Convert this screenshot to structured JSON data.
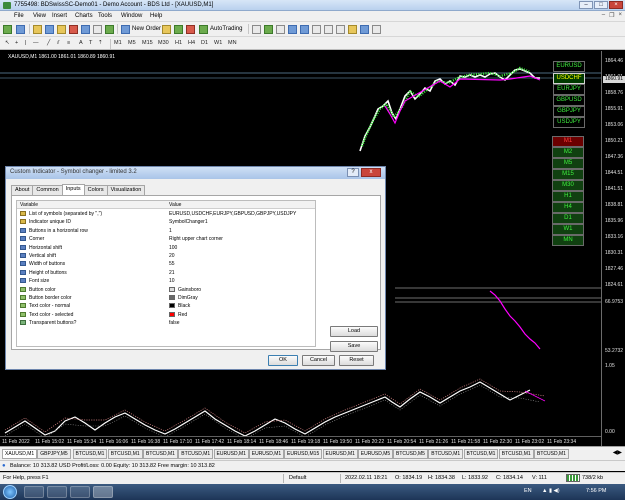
{
  "window": {
    "title": "7755498: BDSwissSC-Demo01 - Demo Account - BDS Ltd - [XAUUSD,M1]"
  },
  "menu": {
    "items": [
      "File",
      "View",
      "Insert",
      "Charts",
      "Tools",
      "Window",
      "Help"
    ]
  },
  "toolbar": {
    "new_order": "New Order",
    "autotrading": "AutoTrading"
  },
  "timeframes": [
    "M1",
    "M5",
    "M15",
    "M30",
    "H1",
    "H4",
    "D1",
    "W1",
    "MN"
  ],
  "chart": {
    "label": "XAUUSD,M1  1861.00 1861.01 1860.89 1860.91",
    "price_labels": [
      "1864.46",
      "1861.01",
      "1858.76",
      "1855.91",
      "1853.06",
      "1850.21",
      "1847.36",
      "1844.51",
      "1841.51",
      "1838.81",
      "1835.96",
      "1833.16",
      "1830.31",
      "1827.46",
      "1824.61",
      "66.9753",
      "53.2732",
      "1.05",
      "0.00"
    ],
    "current_price": "1860.91",
    "time_labels": [
      "11 Feb 2022",
      "11 Feb 15:02",
      "11 Feb 15:34",
      "11 Feb 16:06",
      "11 Feb 16:38",
      "11 Feb 17:10",
      "11 Feb 17:42",
      "11 Feb 18:14",
      "11 Feb 18:46",
      "11 Feb 19:18",
      "11 Feb 19:50",
      "11 Feb 20:22",
      "11 Feb 20:54",
      "11 Feb 21:26",
      "11 Feb 21:58",
      "11 Feb 22:30",
      "11 Feb 23:02",
      "11 Feb 23:34"
    ],
    "symbol_buttons": [
      "EURUSD",
      "USDCHF",
      "EURJPY",
      "GBPUSD",
      "GBPJPY",
      "USDJPY"
    ],
    "selected_symbol": "USDCHF",
    "timeframe_buttons": [
      "M1",
      "M2",
      "M5",
      "M15",
      "M30",
      "H1",
      "H4",
      "D1",
      "W1",
      "MN"
    ],
    "selected_timeframe": "M1"
  },
  "dialog": {
    "title": "Custom Indicator - Symbol changer - limited 3.2",
    "help": "?",
    "close": "x",
    "tabs": [
      "About",
      "Common",
      "Inputs",
      "Colors",
      "Visualization"
    ],
    "active_tab": "Inputs",
    "columns": [
      "Variable",
      "Value"
    ],
    "rows": [
      {
        "name": "List of symbols (separated by \",\")",
        "value": "EURUSD,USDCHF,EURJPY,GBPUSD,GBPJPY,USDJPY",
        "kind": "s"
      },
      {
        "name": "Indicator unique ID",
        "value": "SymbolChanger1",
        "kind": "s"
      },
      {
        "name": "Buttons in a horizontal row",
        "value": "1",
        "kind": "n"
      },
      {
        "name": "Corner",
        "value": "Right upper chart corner",
        "kind": "n"
      },
      {
        "name": "Horizontal shift",
        "value": "100",
        "kind": "n"
      },
      {
        "name": "Vertical shift",
        "value": "20",
        "kind": "n"
      },
      {
        "name": "Width of buttons",
        "value": "55",
        "kind": "n"
      },
      {
        "name": "Height of buttons",
        "value": "21",
        "kind": "n"
      },
      {
        "name": "Font size",
        "value": "10",
        "kind": "n"
      },
      {
        "name": "Button color",
        "value": "Gainsboro",
        "kind": "c",
        "swatch": "#dcdcdc"
      },
      {
        "name": "Button border color",
        "value": "DimGray",
        "kind": "c",
        "swatch": "#696969"
      },
      {
        "name": "Text color - normal",
        "value": "Black",
        "kind": "c",
        "swatch": "#000000"
      },
      {
        "name": "Text color - selected",
        "value": "Red",
        "kind": "c",
        "swatch": "#ff0000"
      },
      {
        "name": "Transparent buttons?",
        "value": "false",
        "kind": "t"
      }
    ],
    "buttons": {
      "load": "Load",
      "save": "Save",
      "ok": "OK",
      "cancel": "Cancel",
      "reset": "Reset"
    }
  },
  "chart_tabs": [
    "XAUUSD,M1",
    "GBPJPY,M5",
    "BTCUSD,M1",
    "BTCUSD,M1",
    "BTCUSD,M1",
    "BTCUSD,M1",
    "EURUSD,M1",
    "EURUSD,M1",
    "EURUSD,M15",
    "EURUSD,M1",
    "EURUSD,M5",
    "BTCUSD,M5",
    "BTCUSD,M1",
    "BTCUSD,M1",
    "BTCUSD,M1",
    "BTCUSD,M1"
  ],
  "active_chart_tab": 0,
  "balance_line": "Balance: 10 313.82 USD  Profit/Loss: 0.00  Equity: 10 313.82  Free margin: 10 313.82",
  "status": {
    "help": "For Help, press F1",
    "profile": "Default",
    "datetime": "2022.02.11 18:21",
    "open": "O: 1834.19",
    "high": "H: 1834.38",
    "low": "L: 1833.92",
    "close": "C: 1834.14",
    "volume": "V: 111",
    "traffic": "738/2 kb"
  },
  "taskbar": {
    "lang": "EN",
    "time": "7:56 PM"
  },
  "colors": {
    "bull": "#3ff03f",
    "bear": "#ff00ff",
    "line": "#ffffff"
  }
}
